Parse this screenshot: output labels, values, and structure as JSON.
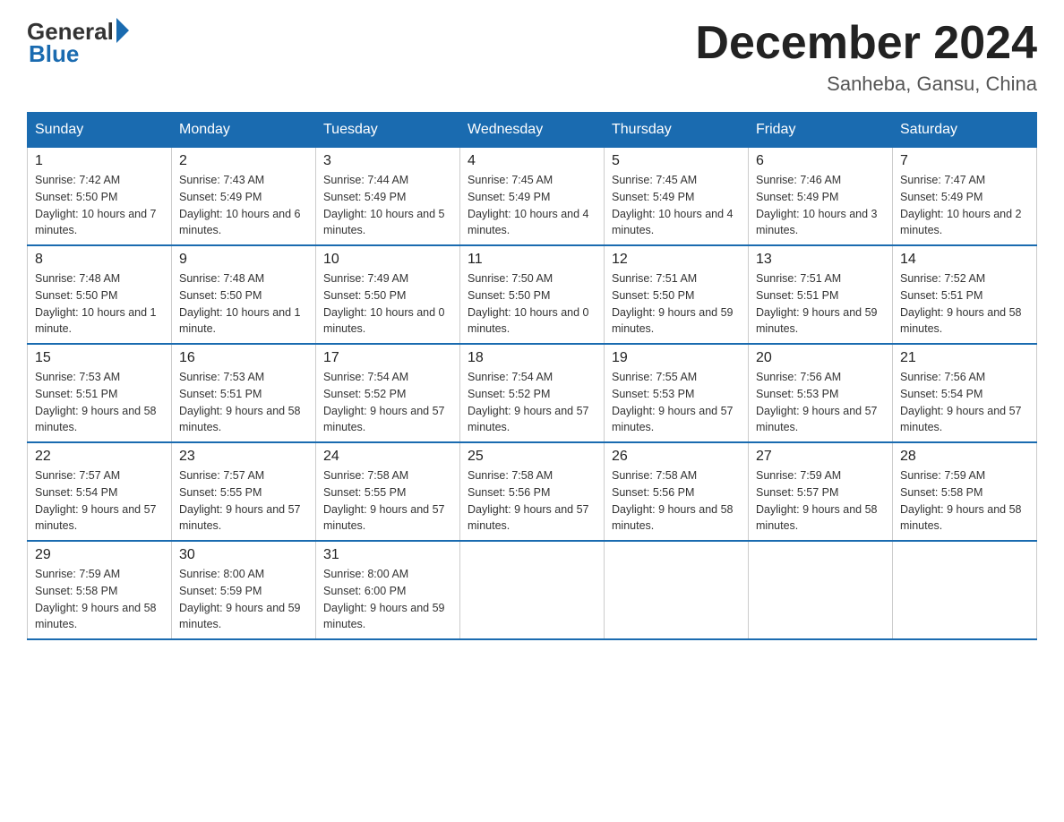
{
  "logo": {
    "general": "General",
    "blue": "Blue"
  },
  "title": "December 2024",
  "location": "Sanheba, Gansu, China",
  "days_of_week": [
    "Sunday",
    "Monday",
    "Tuesday",
    "Wednesday",
    "Thursday",
    "Friday",
    "Saturday"
  ],
  "weeks": [
    [
      {
        "day": "1",
        "sunrise": "7:42 AM",
        "sunset": "5:50 PM",
        "daylight": "10 hours and 7 minutes."
      },
      {
        "day": "2",
        "sunrise": "7:43 AM",
        "sunset": "5:49 PM",
        "daylight": "10 hours and 6 minutes."
      },
      {
        "day": "3",
        "sunrise": "7:44 AM",
        "sunset": "5:49 PM",
        "daylight": "10 hours and 5 minutes."
      },
      {
        "day": "4",
        "sunrise": "7:45 AM",
        "sunset": "5:49 PM",
        "daylight": "10 hours and 4 minutes."
      },
      {
        "day": "5",
        "sunrise": "7:45 AM",
        "sunset": "5:49 PM",
        "daylight": "10 hours and 4 minutes."
      },
      {
        "day": "6",
        "sunrise": "7:46 AM",
        "sunset": "5:49 PM",
        "daylight": "10 hours and 3 minutes."
      },
      {
        "day": "7",
        "sunrise": "7:47 AM",
        "sunset": "5:49 PM",
        "daylight": "10 hours and 2 minutes."
      }
    ],
    [
      {
        "day": "8",
        "sunrise": "7:48 AM",
        "sunset": "5:50 PM",
        "daylight": "10 hours and 1 minute."
      },
      {
        "day": "9",
        "sunrise": "7:48 AM",
        "sunset": "5:50 PM",
        "daylight": "10 hours and 1 minute."
      },
      {
        "day": "10",
        "sunrise": "7:49 AM",
        "sunset": "5:50 PM",
        "daylight": "10 hours and 0 minutes."
      },
      {
        "day": "11",
        "sunrise": "7:50 AM",
        "sunset": "5:50 PM",
        "daylight": "10 hours and 0 minutes."
      },
      {
        "day": "12",
        "sunrise": "7:51 AM",
        "sunset": "5:50 PM",
        "daylight": "9 hours and 59 minutes."
      },
      {
        "day": "13",
        "sunrise": "7:51 AM",
        "sunset": "5:51 PM",
        "daylight": "9 hours and 59 minutes."
      },
      {
        "day": "14",
        "sunrise": "7:52 AM",
        "sunset": "5:51 PM",
        "daylight": "9 hours and 58 minutes."
      }
    ],
    [
      {
        "day": "15",
        "sunrise": "7:53 AM",
        "sunset": "5:51 PM",
        "daylight": "9 hours and 58 minutes."
      },
      {
        "day": "16",
        "sunrise": "7:53 AM",
        "sunset": "5:51 PM",
        "daylight": "9 hours and 58 minutes."
      },
      {
        "day": "17",
        "sunrise": "7:54 AM",
        "sunset": "5:52 PM",
        "daylight": "9 hours and 57 minutes."
      },
      {
        "day": "18",
        "sunrise": "7:54 AM",
        "sunset": "5:52 PM",
        "daylight": "9 hours and 57 minutes."
      },
      {
        "day": "19",
        "sunrise": "7:55 AM",
        "sunset": "5:53 PM",
        "daylight": "9 hours and 57 minutes."
      },
      {
        "day": "20",
        "sunrise": "7:56 AM",
        "sunset": "5:53 PM",
        "daylight": "9 hours and 57 minutes."
      },
      {
        "day": "21",
        "sunrise": "7:56 AM",
        "sunset": "5:54 PM",
        "daylight": "9 hours and 57 minutes."
      }
    ],
    [
      {
        "day": "22",
        "sunrise": "7:57 AM",
        "sunset": "5:54 PM",
        "daylight": "9 hours and 57 minutes."
      },
      {
        "day": "23",
        "sunrise": "7:57 AM",
        "sunset": "5:55 PM",
        "daylight": "9 hours and 57 minutes."
      },
      {
        "day": "24",
        "sunrise": "7:58 AM",
        "sunset": "5:55 PM",
        "daylight": "9 hours and 57 minutes."
      },
      {
        "day": "25",
        "sunrise": "7:58 AM",
        "sunset": "5:56 PM",
        "daylight": "9 hours and 57 minutes."
      },
      {
        "day": "26",
        "sunrise": "7:58 AM",
        "sunset": "5:56 PM",
        "daylight": "9 hours and 58 minutes."
      },
      {
        "day": "27",
        "sunrise": "7:59 AM",
        "sunset": "5:57 PM",
        "daylight": "9 hours and 58 minutes."
      },
      {
        "day": "28",
        "sunrise": "7:59 AM",
        "sunset": "5:58 PM",
        "daylight": "9 hours and 58 minutes."
      }
    ],
    [
      {
        "day": "29",
        "sunrise": "7:59 AM",
        "sunset": "5:58 PM",
        "daylight": "9 hours and 58 minutes."
      },
      {
        "day": "30",
        "sunrise": "8:00 AM",
        "sunset": "5:59 PM",
        "daylight": "9 hours and 59 minutes."
      },
      {
        "day": "31",
        "sunrise": "8:00 AM",
        "sunset": "6:00 PM",
        "daylight": "9 hours and 59 minutes."
      },
      null,
      null,
      null,
      null
    ]
  ],
  "labels": {
    "sunrise": "Sunrise:",
    "sunset": "Sunset:",
    "daylight": "Daylight:"
  }
}
